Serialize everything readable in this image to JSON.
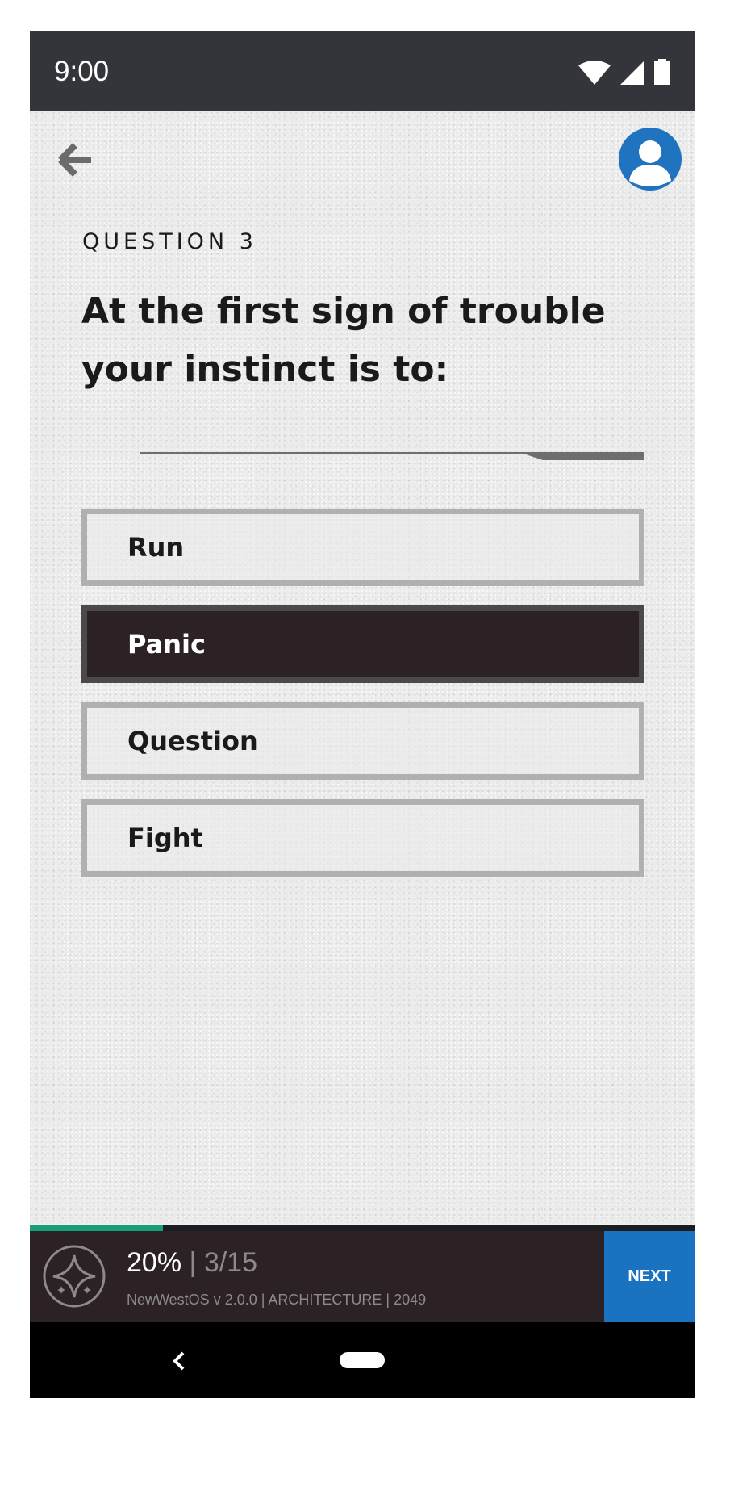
{
  "status_bar": {
    "time": "9:00"
  },
  "quiz": {
    "question_label": "QUESTION 3",
    "question_text": "At the first sign of trouble your instinct is to:",
    "options": [
      {
        "label": "Run",
        "selected": false
      },
      {
        "label": "Panic",
        "selected": true
      },
      {
        "label": "Question",
        "selected": false
      },
      {
        "label": "Fight",
        "selected": false
      }
    ]
  },
  "footer": {
    "percent": "20%",
    "separator": "|",
    "count": "3/15",
    "subtitle": "NewWestOS v 2.0.0 | ARCHITECTURE | 2049",
    "next_label": "NEXT",
    "progress_fraction": 0.2
  },
  "colors": {
    "accent_blue": "#1a73c1",
    "progress_green": "#17a078",
    "dark_panel": "#2c2226"
  },
  "icons": [
    "back-arrow-icon",
    "profile-icon",
    "wifi-icon",
    "signal-icon",
    "battery-icon",
    "star-logo-icon",
    "nav-back-icon",
    "nav-home-icon"
  ]
}
